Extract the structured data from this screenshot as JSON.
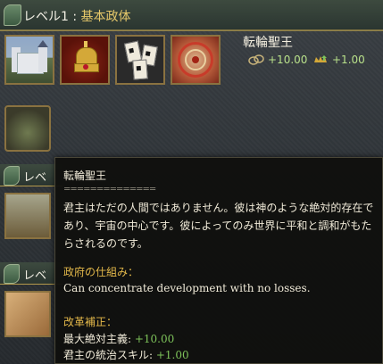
{
  "header": {
    "level_label": "レベル1",
    "separator": " : ",
    "level_value": "基本政体"
  },
  "government": {
    "title": "転輪聖王",
    "modifiers": [
      {
        "icon": "absolutism-icon",
        "value": "+10.00"
      },
      {
        "icon": "crown-arrow-icon",
        "value": "+1.00"
      }
    ]
  },
  "sidebar": {
    "banners": [
      {
        "label": "レベ"
      },
      {
        "label": "レベ"
      }
    ]
  },
  "background_text": "",
  "tooltip": {
    "title": "転輪聖王",
    "separator": "==============",
    "description": "君主はただの人間ではありません。彼は神のような絶対的存在であり、宇宙の中心です。彼によってのみ世界に平和と調和がもたらされるのです。",
    "mechanics_heading": "政府の仕組み：",
    "mechanics_text": "Can concentrate development with no losses.",
    "reforms_heading": "改革補正：",
    "reforms": [
      {
        "label": "最大絶対主義: ",
        "value": "+10.00"
      },
      {
        "label": "君主の統治スキル: ",
        "value": "+1.00"
      }
    ]
  },
  "colors": {
    "accent_gold": "#e3b84a",
    "positive_green": "#7ec35a",
    "header_value": "#e6c86a"
  }
}
